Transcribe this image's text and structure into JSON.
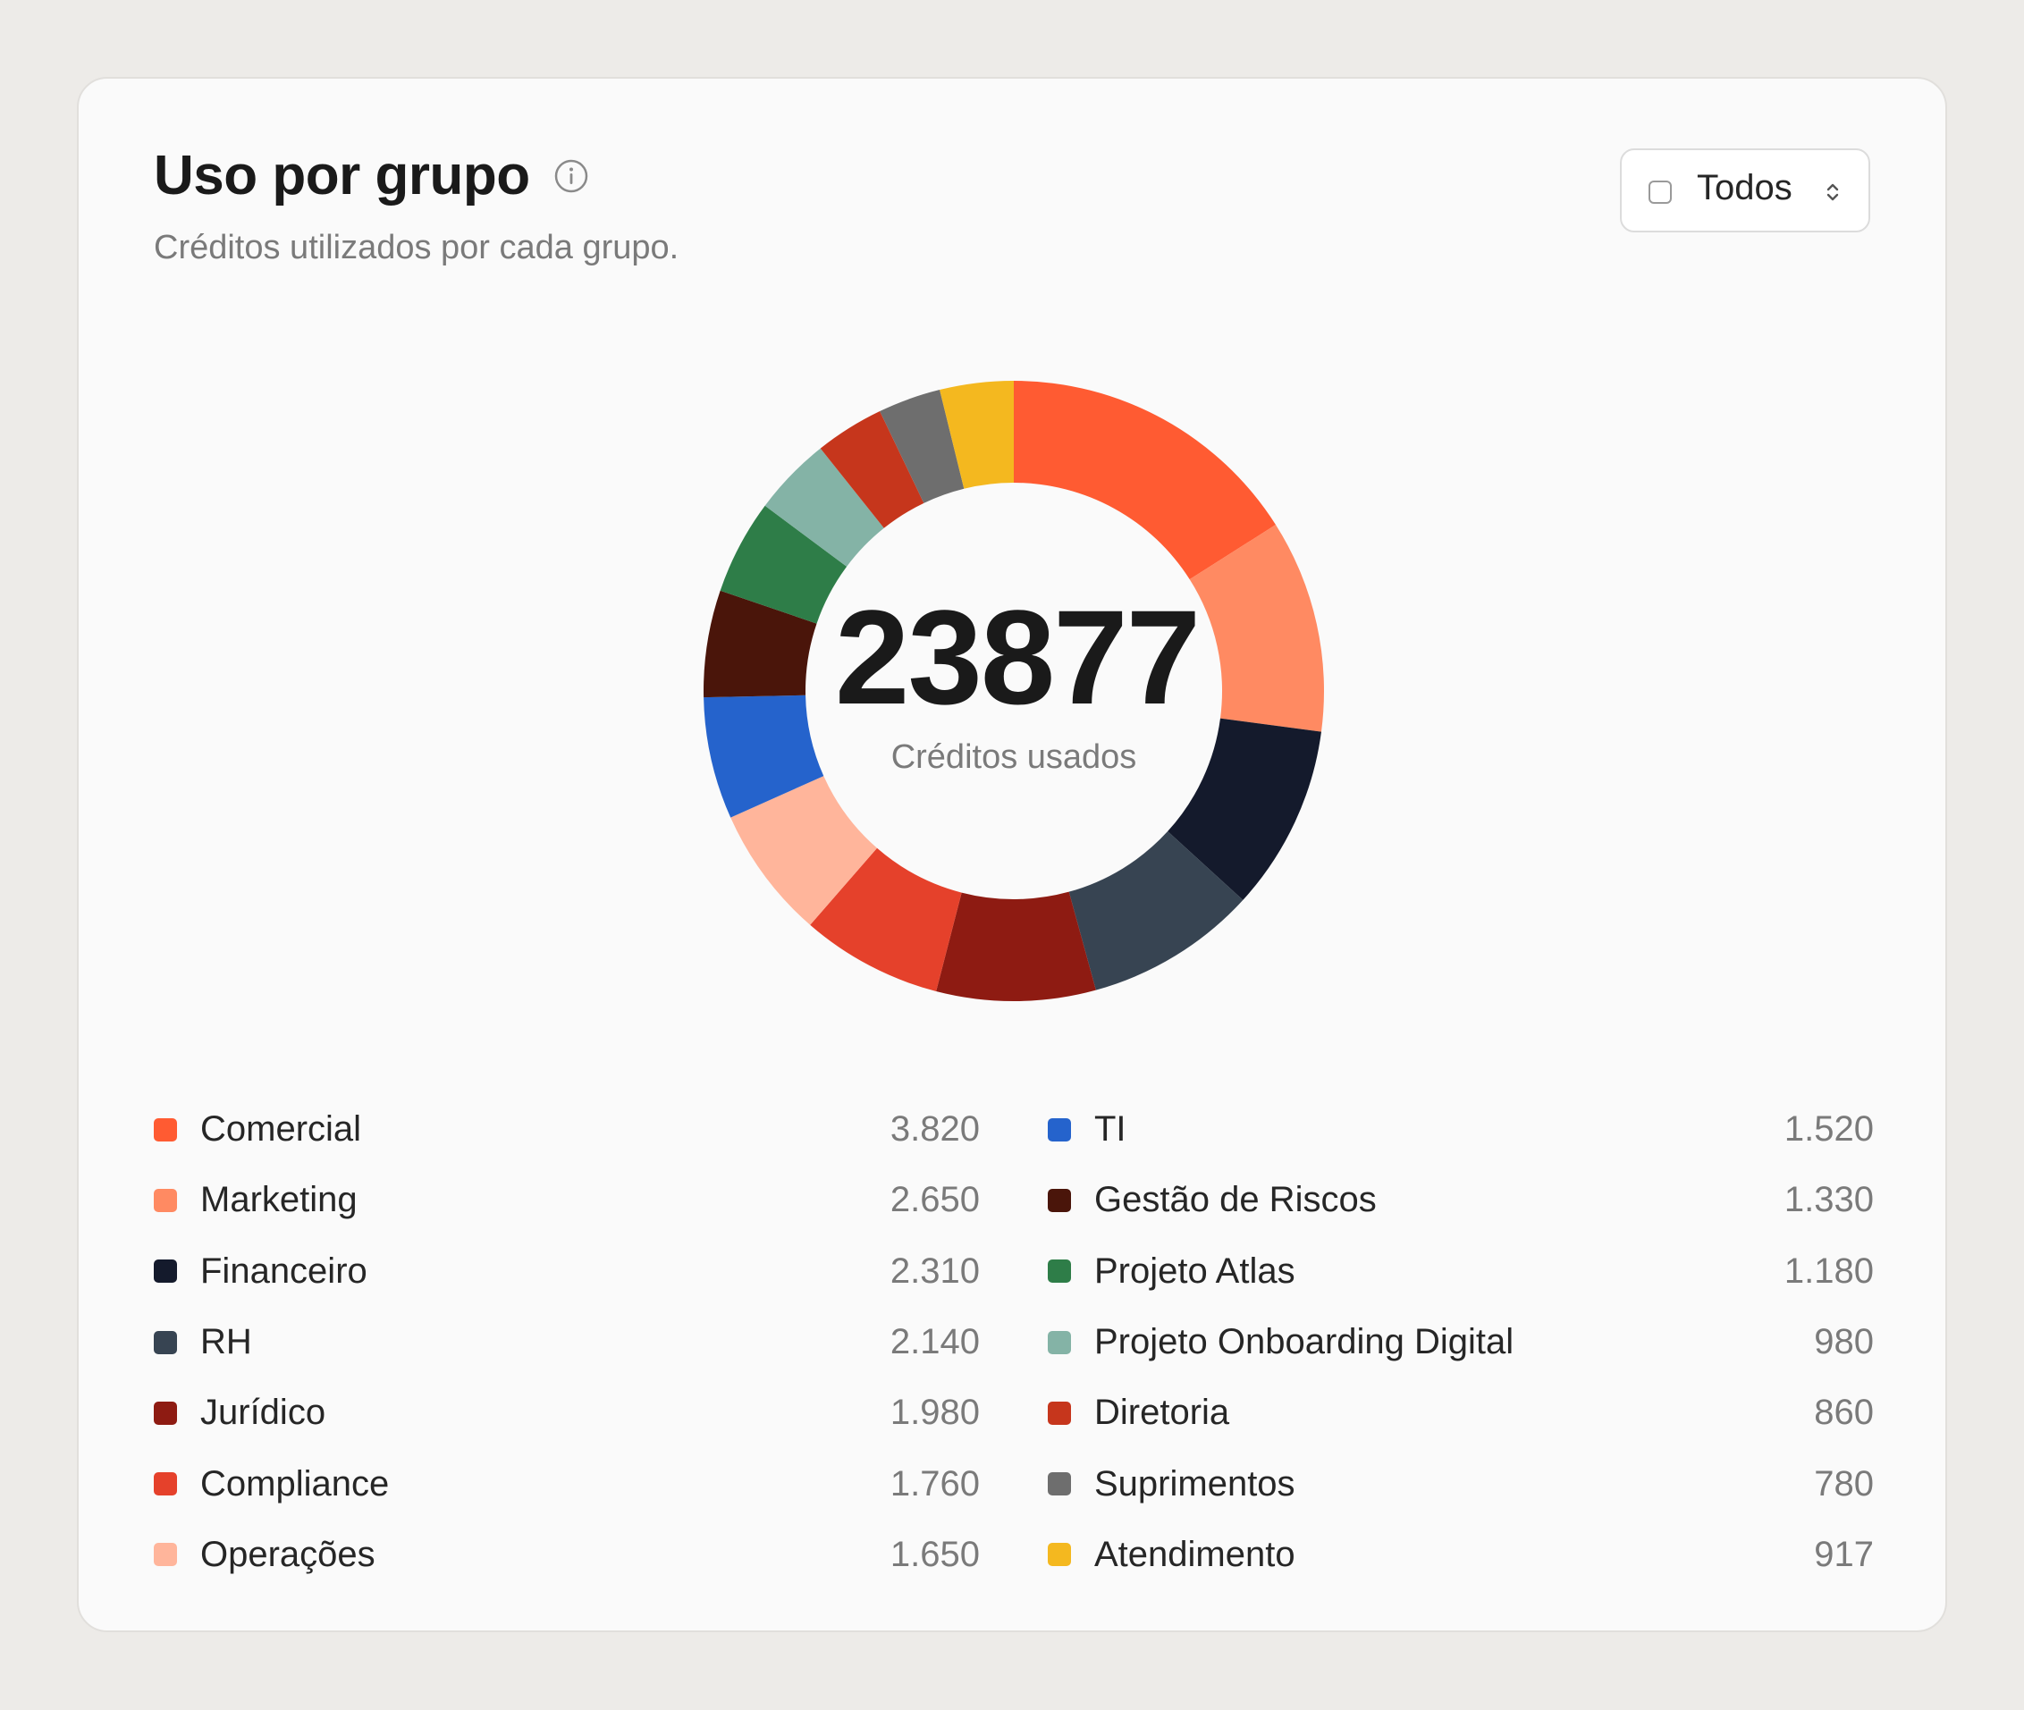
{
  "header": {
    "title": "Uso por grupo",
    "subtitle": "Créditos utilizados por cada grupo.",
    "info_icon": "info-icon"
  },
  "filter": {
    "label": "Todos",
    "checked": false,
    "icon": "chevron-updown-icon"
  },
  "center": {
    "value": "23877",
    "label": "Créditos usados"
  },
  "legend": {
    "left": [
      {
        "name": "Comercial",
        "value_text": "3.820",
        "color": "#ff5b32"
      },
      {
        "name": "Marketing",
        "value_text": "2.650",
        "color": "#ff8a62"
      },
      {
        "name": "Financeiro",
        "value_text": "2.310",
        "color": "#141a2c"
      },
      {
        "name": "RH",
        "value_text": "2.140",
        "color": "#374452"
      },
      {
        "name": "Jurídico",
        "value_text": "1.980",
        "color": "#8e1b12"
      },
      {
        "name": "Compliance",
        "value_text": "1.760",
        "color": "#e5412b"
      },
      {
        "name": "Operações",
        "value_text": "1.650",
        "color": "#ffb59b"
      }
    ],
    "right": [
      {
        "name": "TI",
        "value_text": "1.520",
        "color": "#2563cc"
      },
      {
        "name": "Gestão de Riscos",
        "value_text": "1.330",
        "color": "#4a150a"
      },
      {
        "name": "Projeto Atlas",
        "value_text": "1.180",
        "color": "#2e7d48"
      },
      {
        "name": "Projeto Onboarding Digital",
        "value_text": "980",
        "color": "#84b3a6"
      },
      {
        "name": "Diretoria",
        "value_text": "860",
        "color": "#c6361c"
      },
      {
        "name": "Suprimentos",
        "value_text": "780",
        "color": "#6e6e6e"
      },
      {
        "name": "Atendimento",
        "value_text": "917",
        "color": "#f4b81f"
      }
    ]
  },
  "chart_data": {
    "type": "pie",
    "donut": true,
    "title": "Uso por grupo",
    "subtitle": "Créditos utilizados por cada grupo.",
    "center_value": 23877,
    "center_label": "Créditos usados",
    "categories": [
      "Comercial",
      "Marketing",
      "Financeiro",
      "RH",
      "Jurídico",
      "Compliance",
      "Operações",
      "TI",
      "Gestão de Riscos",
      "Projeto Atlas",
      "Projeto Onboarding Digital",
      "Diretoria",
      "Suprimentos",
      "Atendimento"
    ],
    "values": [
      3820,
      2650,
      2310,
      2140,
      1980,
      1760,
      1650,
      1520,
      1330,
      1180,
      980,
      860,
      780,
      917
    ],
    "colors": [
      "#ff5b32",
      "#ff8a62",
      "#141a2c",
      "#374452",
      "#8e1b12",
      "#e5412b",
      "#ffb59b",
      "#2563cc",
      "#4a150a",
      "#2e7d48",
      "#84b3a6",
      "#c6361c",
      "#6e6e6e",
      "#f4b81f"
    ],
    "start": "top",
    "direction": "clockwise",
    "legend_position": "bottom"
  }
}
